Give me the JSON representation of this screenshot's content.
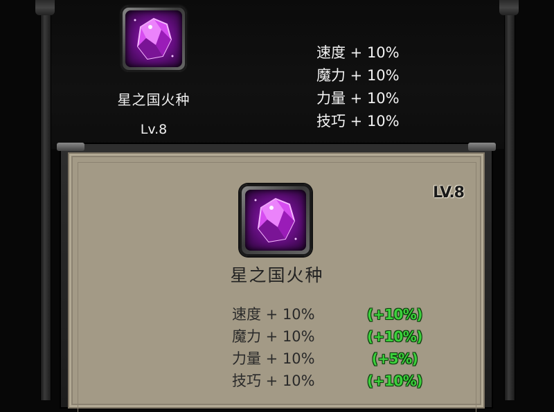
{
  "item": {
    "name": "星之国火种",
    "level_label": "Lv.8",
    "icon": "purple-gem-icon"
  },
  "top_stats": [
    "速度 + 10%",
    "魔力 + 10%",
    "力量 + 10%",
    "技巧 + 10%"
  ],
  "panel": {
    "level_badge": "LV.8",
    "name": "星之国火种",
    "stats": [
      {
        "text": "速度 + 10%",
        "bonus": "(+10%)"
      },
      {
        "text": "魔力 + 10%",
        "bonus": "(+10%)"
      },
      {
        "text": "力量 + 10%",
        "bonus": "(+5%)"
      },
      {
        "text": "技巧 + 10%",
        "bonus": "(+10%)"
      }
    ]
  },
  "colors": {
    "bonus_green": "#3cd03c",
    "gem_purple": "#c02bd8",
    "parchment": "#a39a86"
  }
}
